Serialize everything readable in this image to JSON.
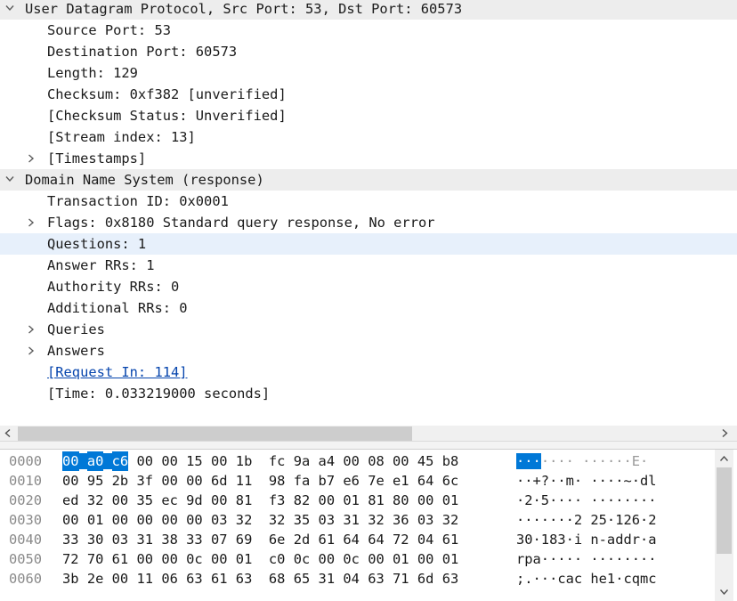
{
  "details": {
    "rows": [
      {
        "text": "User Datagram Protocol, Src Port: 53, Dst Port: 60573",
        "level": 0,
        "expander": "expanded",
        "header": true
      },
      {
        "text": "Source Port: 53",
        "level": 1
      },
      {
        "text": "Destination Port: 60573",
        "level": 1
      },
      {
        "text": "Length: 129",
        "level": 1
      },
      {
        "text": "Checksum: 0xf382 [unverified]",
        "level": 1
      },
      {
        "text": "[Checksum Status: Unverified]",
        "level": 1
      },
      {
        "text": "[Stream index: 13]",
        "level": 1
      },
      {
        "text": "[Timestamps]",
        "level": 1,
        "expander": "collapsed"
      },
      {
        "text": "Domain Name System (response)",
        "level": 0,
        "expander": "expanded",
        "header": true
      },
      {
        "text": "Transaction ID: 0x0001",
        "level": 1
      },
      {
        "text": "Flags: 0x8180 Standard query response, No error",
        "level": 1,
        "expander": "collapsed"
      },
      {
        "text": "Questions: 1",
        "level": 1,
        "selected": true
      },
      {
        "text": "Answer RRs: 1",
        "level": 1
      },
      {
        "text": "Authority RRs: 0",
        "level": 1
      },
      {
        "text": "Additional RRs: 0",
        "level": 1
      },
      {
        "text": "Queries",
        "level": 1,
        "expander": "collapsed"
      },
      {
        "text": "Answers",
        "level": 1,
        "expander": "collapsed"
      },
      {
        "text": "[Request In: 114]",
        "level": 1,
        "link": true
      },
      {
        "text": "[Time: 0.033219000 seconds]",
        "level": 1
      }
    ]
  },
  "bytes": {
    "rows": [
      {
        "offset": "0000",
        "hex": [
          "00",
          "a0",
          "c6",
          "00",
          "00",
          "15",
          "00",
          "1b",
          "fc",
          "9a",
          "a4",
          "00",
          "08",
          "00",
          "45",
          "b8"
        ],
        "ascii": "······· ······E·"
      },
      {
        "offset": "0010",
        "hex": [
          "00",
          "95",
          "2b",
          "3f",
          "00",
          "00",
          "6d",
          "11",
          "98",
          "fa",
          "b7",
          "e6",
          "7e",
          "e1",
          "64",
          "6c"
        ],
        "ascii": "··+?··m· ····~·dl"
      },
      {
        "offset": "0020",
        "hex": [
          "ed",
          "32",
          "00",
          "35",
          "ec",
          "9d",
          "00",
          "81",
          "f3",
          "82",
          "00",
          "01",
          "81",
          "80",
          "00",
          "01"
        ],
        "ascii": "·2·5···· ········"
      },
      {
        "offset": "0030",
        "hex": [
          "00",
          "01",
          "00",
          "00",
          "00",
          "00",
          "03",
          "32",
          "32",
          "35",
          "03",
          "31",
          "32",
          "36",
          "03",
          "32"
        ],
        "ascii": "·······2 25·126·2"
      },
      {
        "offset": "0040",
        "hex": [
          "33",
          "30",
          "03",
          "31",
          "38",
          "33",
          "07",
          "69",
          "6e",
          "2d",
          "61",
          "64",
          "64",
          "72",
          "04",
          "61"
        ],
        "ascii": "30·183·i n-addr·a"
      },
      {
        "offset": "0050",
        "hex": [
          "72",
          "70",
          "61",
          "00",
          "00",
          "0c",
          "00",
          "01",
          "c0",
          "0c",
          "00",
          "0c",
          "00",
          "01",
          "00",
          "01"
        ],
        "ascii": "rpa····· ········"
      },
      {
        "offset": "0060",
        "hex": [
          "3b",
          "2e",
          "00",
          "11",
          "06",
          "63",
          "61",
          "63",
          "68",
          "65",
          "31",
          "04",
          "63",
          "71",
          "6d",
          "63"
        ],
        "ascii": ";.···cac he1·cqmc"
      }
    ],
    "highlight_bytes": 3,
    "highlight_ascii": "···",
    "colors": {
      "highlight": "#0078d7",
      "link": "#0645ad",
      "selected_row": "#e7f0fb"
    }
  }
}
